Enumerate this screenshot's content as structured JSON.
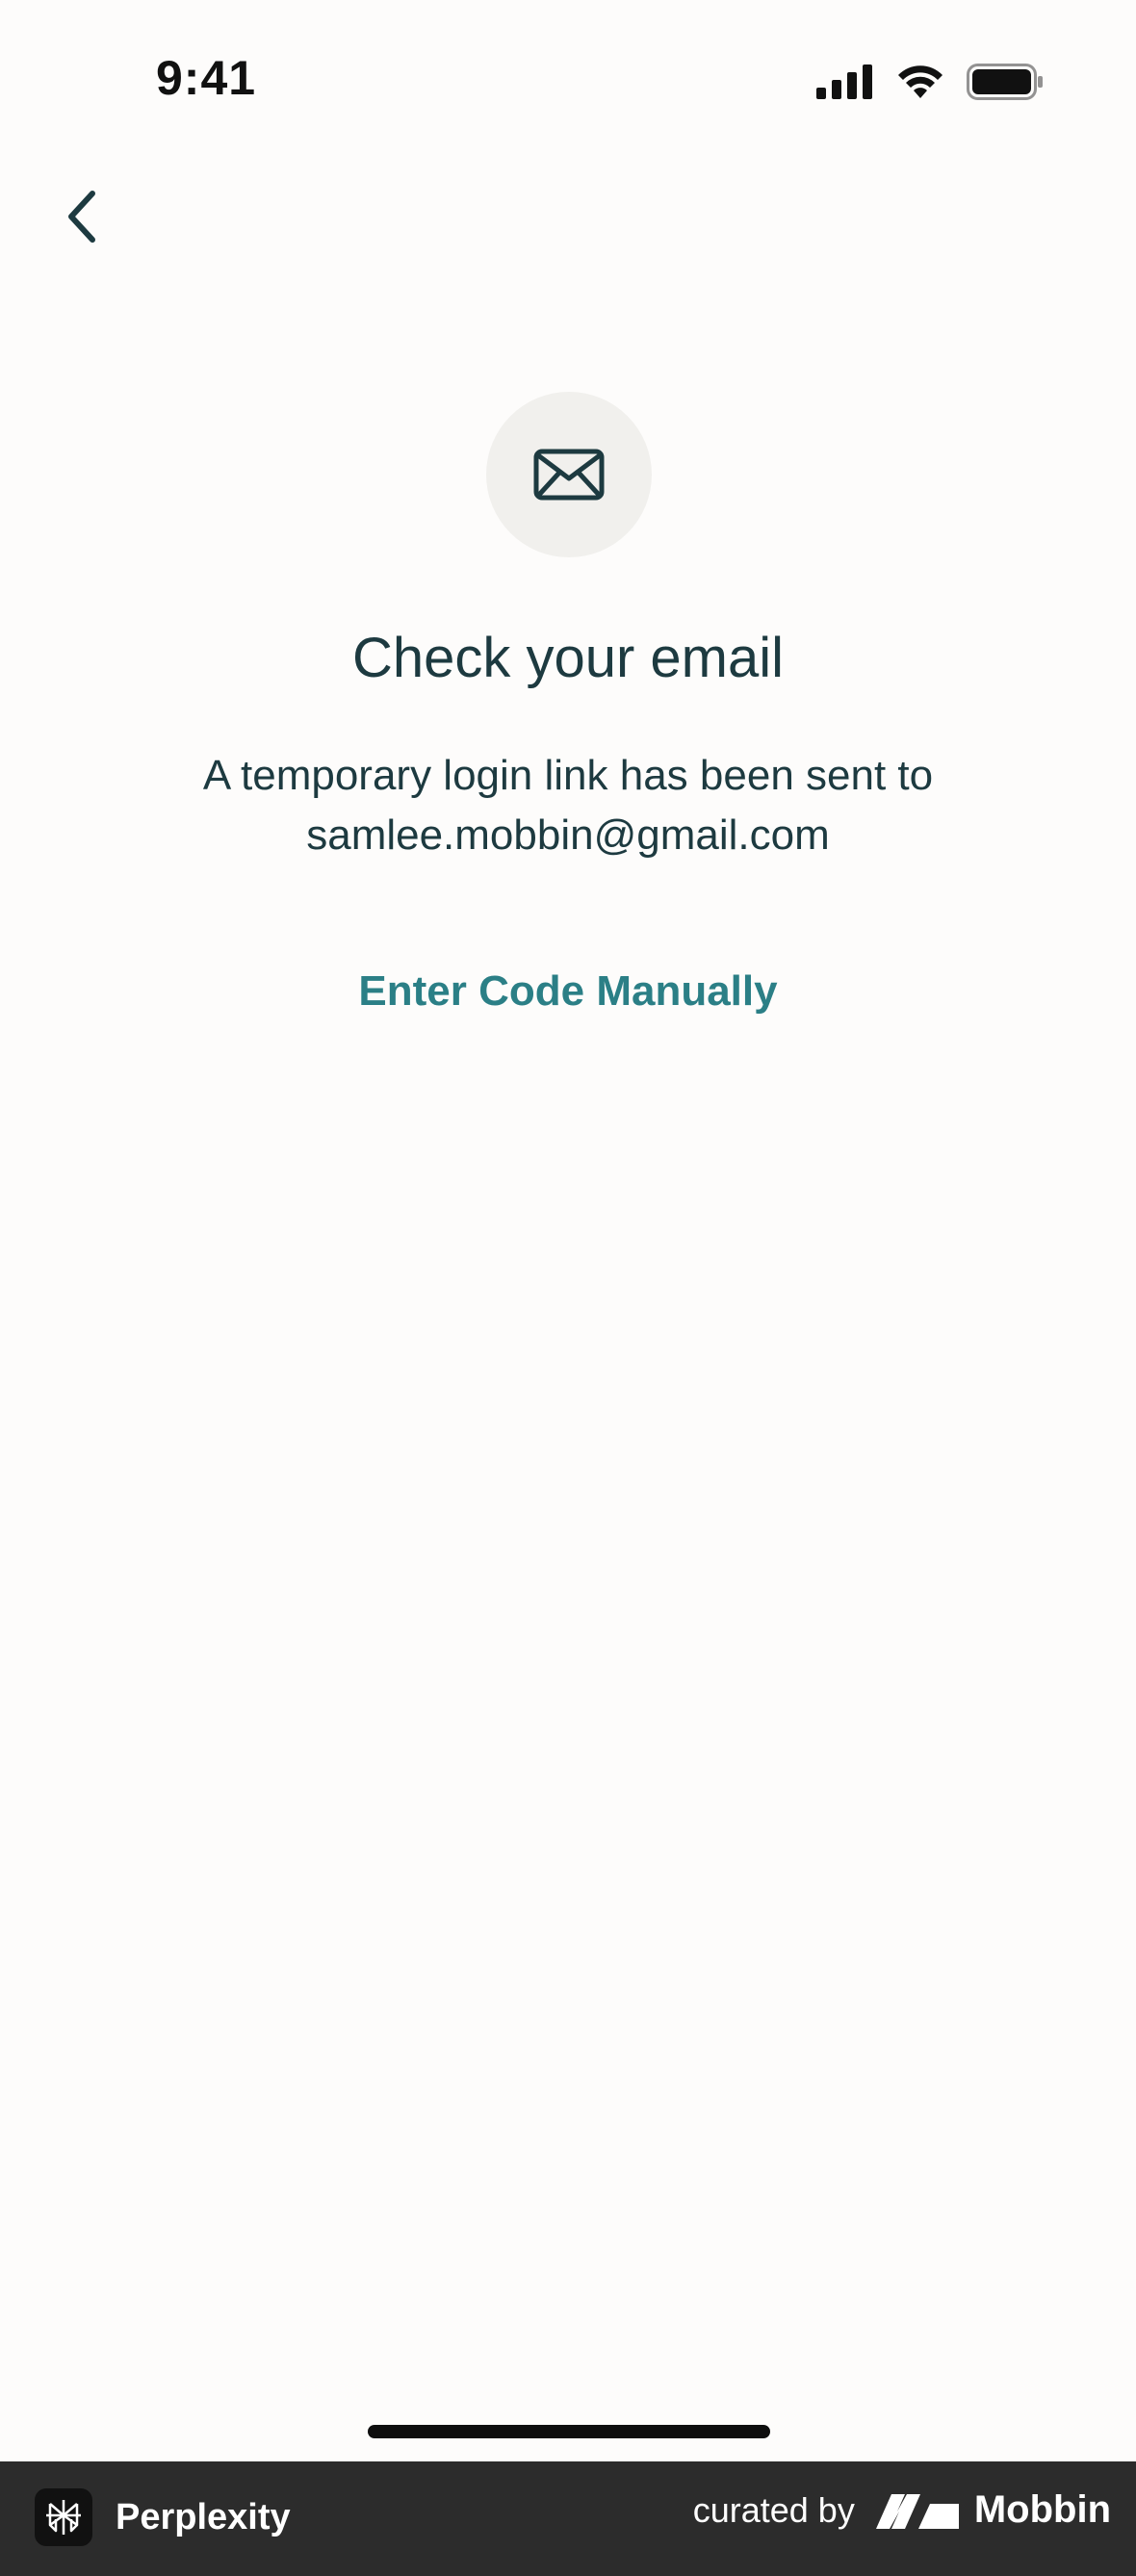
{
  "status_bar": {
    "time": "9:41",
    "icons": [
      "cellular-signal-icon",
      "wifi-icon",
      "battery-icon"
    ]
  },
  "nav": {
    "back_icon": "chevron-left-icon"
  },
  "content": {
    "icon": "mail-icon",
    "title": "Check your email",
    "message_line1": "A temporary login link has been sent to",
    "email": "samlee.mobbin@gmail.com",
    "enter_code_label": "Enter Code Manually"
  },
  "footer": {
    "app_name": "Perplexity",
    "curated_by": "curated by",
    "brand": "Mobbin"
  },
  "colors": {
    "background": "#fdfcfb",
    "text": "#1d3a40",
    "accent": "#2b7f86",
    "icon_circle": "#f1f0ed",
    "footer_bg": "#2c2c2c"
  }
}
